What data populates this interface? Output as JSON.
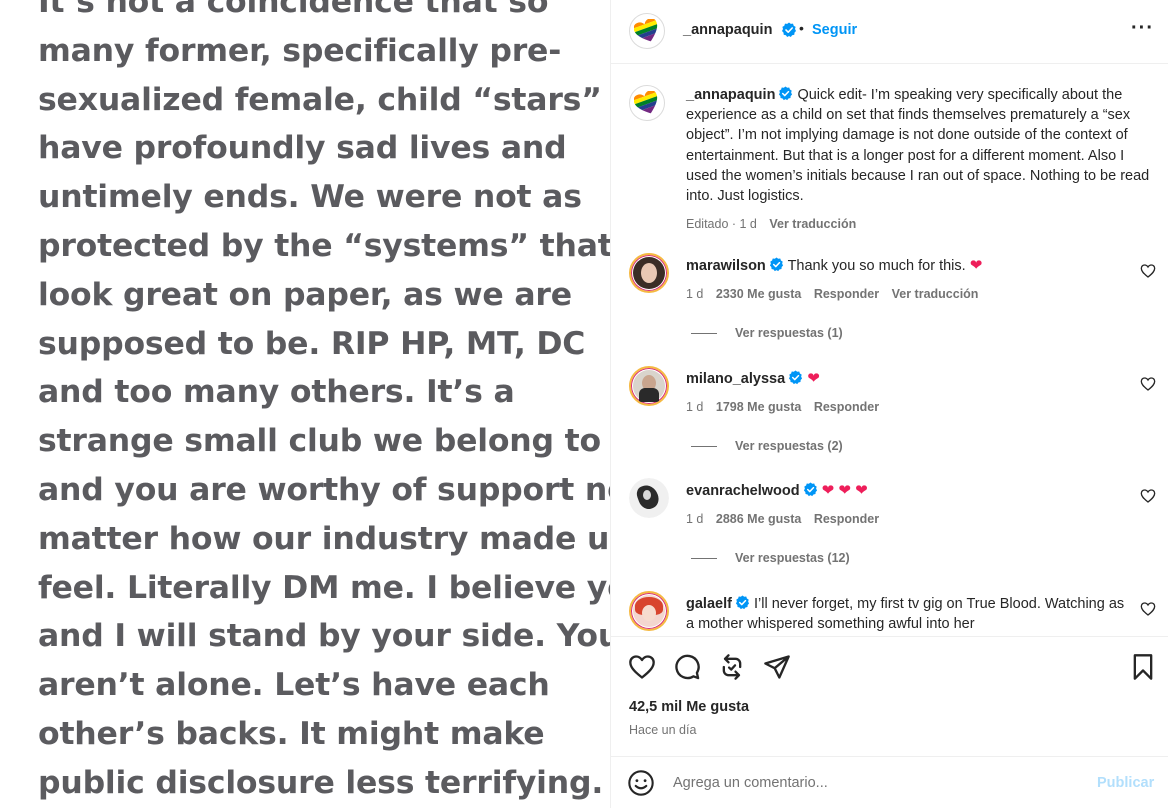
{
  "post_image": {
    "lines": [
      "It’s not a coincidence that so",
      "many former, specifically pre-",
      "sexualized  female, child “stars”",
      "have profoundly sad lives and",
      "untimely ends. We were not as",
      "protected by the “systems” that",
      "look great on paper, as we are",
      "supposed to be.  RIP HP, MT, DC",
      "and too many others. It’s a",
      "strange small club we belong to",
      "and you are worthy of support no",
      "matter how our industry made us",
      "feel. Literally DM me. I believe you",
      "and I will stand by your side. You",
      "aren’t alone. Let’s have each",
      "other’s backs. It might make",
      "public disclosure less terrifying."
    ]
  },
  "header": {
    "username": "_annapaquin",
    "dot": "•",
    "follow_label": "Seguir",
    "more_label": "···"
  },
  "caption": {
    "username": "_annapaquin",
    "text": "Quick edit- I’m speaking very specifically about the experience as a child on set that finds themselves prematurely a “sex object”. I’m not implying damage is not done outside of the context of entertainment. But that is a longer post for a different moment. Also I used the women’s initials because I ran out of space. Nothing to be read into. Just logistics.",
    "edited": "Editado · 1 d",
    "translate": "Ver traducción"
  },
  "comments": [
    {
      "username": "marawilson",
      "text": "Thank you so much for this.",
      "emoji": "❤",
      "age": "1 d",
      "likes": "2330 Me gusta",
      "reply": "Responder",
      "translate": "Ver traducción",
      "replies": "Ver respuestas (1)"
    },
    {
      "username": "milano_alyssa",
      "text": "",
      "emoji": "❤",
      "age": "1 d",
      "likes": "1798 Me gusta",
      "reply": "Responder",
      "replies": "Ver respuestas (2)"
    },
    {
      "username": "evanrachelwood",
      "text": "",
      "emoji": "❤ ❤ ❤",
      "age": "1 d",
      "likes": "2886 Me gusta",
      "reply": "Responder",
      "replies": "Ver respuestas (12)"
    },
    {
      "username": "galaelf",
      "text": "I’ll never forget, my first tv gig on True Blood. Watching as a mother whispered something awful into her"
    }
  ],
  "actions": {
    "likes": "42,5 mil Me gusta",
    "when": "Hace un día"
  },
  "add_comment": {
    "placeholder": "Agrega un comentario...",
    "publish": "Publicar"
  },
  "colors": {
    "link_blue": "#0095f6",
    "verified_blue": "#0095f6",
    "heart_red": "#ee1e5a",
    "muted_gray": "#737373",
    "publish_disabled": "#b2dffc"
  }
}
